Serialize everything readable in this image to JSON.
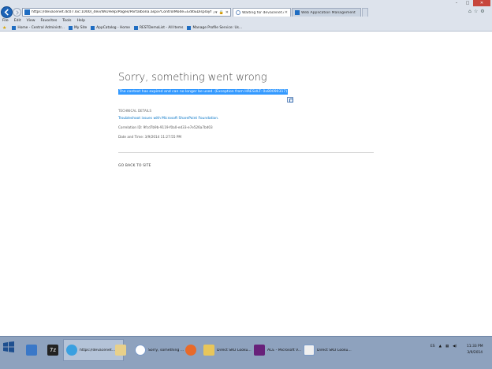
{
  "browser": {
    "address_url": "https://devacenet.dc07.loc:1000/_dev/WiUHelp/Pages/Portalbona.aspx?ControlMode=Edit&DisplayMode=Ds",
    "tabs": [
      {
        "label": "Waiting for devacenet.dc07..."
      },
      {
        "label": "Web Application Management"
      }
    ],
    "menu": [
      "File",
      "Edit",
      "View",
      "Favorites",
      "Tools",
      "Help"
    ],
    "favorites": [
      "Home - Central Administr...",
      "My Site",
      "AppCatalog - Home",
      "RESTDemoList - All Items",
      "Manage Profile Service: Us..."
    ],
    "colors": {
      "back_button": "#1c63b7",
      "selection": "#3399ff",
      "link": "#0072c6",
      "close_button": "#c7463c"
    }
  },
  "page": {
    "title": "Sorry, something went wrong",
    "error_message": "The context has expired and can no longer be used. (Exception from HRESULT: 0x80090317)",
    "tech_details_heading": "TECHNICAL DETAILS",
    "troubleshoot_link": "Troubleshoot issues with Microsoft SharePoint Foundation.",
    "correlation": "Correlation ID: 9fcd7b9b-9119-f0a0-ed33-e7e526a7bd03",
    "datetime": "Date and Time: 3/9/2014 11:27:55 PM",
    "back_link": "GO BACK TO SITE"
  },
  "taskbar": {
    "items": [
      {
        "label": "https://devacenet...",
        "icon": "ie-icon",
        "active": true
      },
      {
        "label": "Sorry, something ...",
        "icon": "ie-icon",
        "active": false
      },
      {
        "label": "Direct SKU Looku...",
        "icon": "folder-icon",
        "active": false
      },
      {
        "label": "ACE - Microsoft V...",
        "icon": "visual-studio-icon",
        "active": false
      },
      {
        "label": "Direct SKU Looku...",
        "icon": "paint-icon",
        "active": false
      }
    ],
    "tray_lang": "ES",
    "clock_time": "11:33 PM",
    "clock_date": "3/9/2014"
  }
}
